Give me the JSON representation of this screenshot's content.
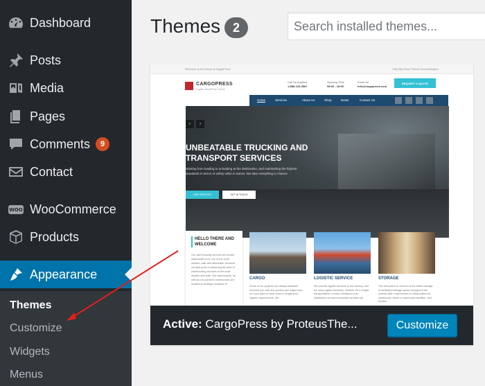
{
  "sidebar": {
    "items": [
      {
        "label": "Dashboard",
        "icon": "dashboard-icon"
      },
      {
        "label": "Posts",
        "icon": "pushpin-icon"
      },
      {
        "label": "Media",
        "icon": "media-icon"
      },
      {
        "label": "Pages",
        "icon": "pages-icon"
      },
      {
        "label": "Comments",
        "icon": "comment-icon",
        "badge": "9"
      },
      {
        "label": "Contact",
        "icon": "envelope-icon"
      },
      {
        "label": "WooCommerce",
        "icon": "woo-icon"
      },
      {
        "label": "Products",
        "icon": "box-icon"
      },
      {
        "label": "Appearance",
        "icon": "paintbrush-icon"
      }
    ],
    "submenu": [
      {
        "label": "Themes"
      },
      {
        "label": "Customize"
      },
      {
        "label": "Widgets"
      },
      {
        "label": "Menus"
      }
    ]
  },
  "header": {
    "title": "Themes",
    "count": "2",
    "search_placeholder": "Search installed themes..."
  },
  "theme": {
    "active_prefix": "Active:",
    "name": "CargoPress by ProteusThe...",
    "customize_label": "Customize",
    "screenshot": {
      "topbar_left": "Welcome to the home of CargoPress",
      "topbar_right": "FAQ   Buy Now   Theme Documentation",
      "logo": "CARGOPRESS",
      "logo_sub": "Logistic WordPress Theme",
      "call_label": "Call Us Anytime",
      "call_value": "1-888-123-4567",
      "hours_label": "Opening Time",
      "hours_value": "08:00 - 18:00",
      "email_label": "Email Us",
      "email_value": "info@cargopress.com",
      "quote_button": "REQUEST A QUOTE",
      "nav": [
        "Home",
        "Services",
        "About Us",
        "Shop",
        "News",
        "Contact Us"
      ],
      "hero_title": "UNBEATABLE TRUCKING AND TRANSPORT SERVICES",
      "hero_text": "Starting from loading to unloading at the destination, and maintaining the highest standards in terms of safety while in transit. We take everything to chance.",
      "hero_btn1": "OUR SERVICES",
      "hero_btn2": "GET IN TOUCH",
      "welcome_title": "HELLO THERE AND WELCOME",
      "welcome_text": "Our warehousing services are known nationwide to be one of the most reliable, safe and affordable, because we take pride in delivering the best of warehousing services at the most reliable and safe. Our warehouses, as well as our partner's warehouses are located at strategic locations in",
      "services": [
        {
          "title": "CARGO",
          "text": "Some of our projects are always available serviced you with any queries you might have, or if you want to know more in length your logistic requirements. We"
        },
        {
          "title": "LOGISTIC SERVICE",
          "text": "We provide logistic services in the country, and we carry logistic business, whether it's a freight transportation, money, remittance and distribution services corporate services we"
        },
        {
          "title": "STORAGE",
          "text": "The best place to come in is the safest storage of dedicated storage space throughout the country with a warehouse or collaboration for warehouse, which is warehouse facilities, and flexible"
        }
      ]
    }
  },
  "colors": {
    "sidebar_bg": "#23282d",
    "active_bg": "#0073aa",
    "button_bg": "#0085ba",
    "annotation_arrow": "#e0201b"
  }
}
